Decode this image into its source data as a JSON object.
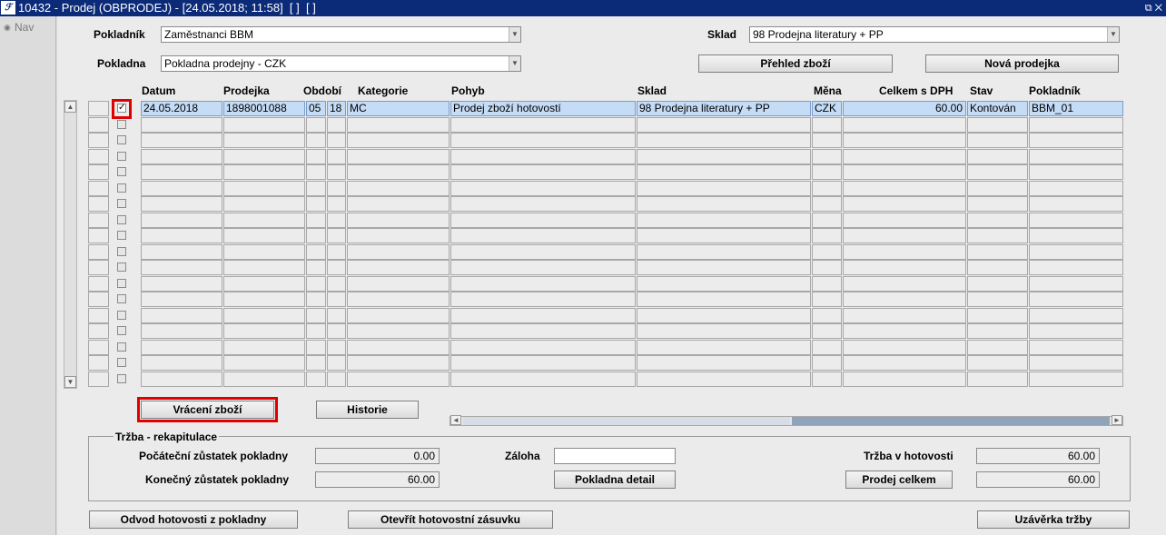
{
  "window": {
    "title": "10432 - Prodej (OBPRODEJ) - [24.05.2018; 11:58]  [ ]  [ ]",
    "app_icon": "forms-app-icon",
    "controls": "⧉ ✕"
  },
  "nav": {
    "label": "Nav"
  },
  "form": {
    "pokladnik_label": "Pokladník",
    "pokladnik_value": "Zaměstnanci BBM",
    "sklad_label": "Sklad",
    "sklad_value": "98 Prodejna literatury + PP",
    "pokladna_label": "Pokladna",
    "pokladna_value": "Pokladna prodejny - CZK",
    "prehled_button": "Přehled zboží",
    "nova_button": "Nová prodejka"
  },
  "table": {
    "headers": {
      "datum": "Datum",
      "prodejka": "Prodejka",
      "obdobi": "Období",
      "kategorie": "Kategorie",
      "pohyb": "Pohyb",
      "sklad": "Sklad",
      "mena": "Měna",
      "celkem": "Celkem s DPH",
      "stav": "Stav",
      "pokladnik": "Pokladník"
    },
    "row": {
      "datum": "24.05.2018",
      "prodejka": "1898001088",
      "obdobi_m": "05",
      "obdobi_y": "18",
      "kategorie": "MC",
      "pohyb": "Prodej zboží hotovostí",
      "sklad": "98 Prodejna literatury + PP",
      "mena": "CZK",
      "celkem": "60.00",
      "stav": "Kontován",
      "pokladnik": "BBM_01",
      "checked": true
    },
    "empty_rows": 17
  },
  "buttons": {
    "vraceni": "Vrácení zboží",
    "historie": "Historie"
  },
  "rekapitulace": {
    "title": "Tržba - rekapitulace",
    "pocatecni_label": "Počáteční zůstatek pokladny",
    "pocatecni_value": "0.00",
    "konecny_label": "Konečný zůstatek pokladny",
    "konecny_value": "60.00",
    "zaloha_label": "Záloha",
    "zaloha_value": "",
    "pokladna_detail_button": "Pokladna detail",
    "trzba_label": "Tržba v hotovosti",
    "trzba_value": "60.00",
    "prodej_celkem_button": "Prodej celkem",
    "prodej_celkem_value": "60.00"
  },
  "footer": {
    "odvod_button": "Odvod hotovosti z pokladny",
    "otevrit_button": "Otevřít hotovostní zásuvku",
    "uzaverka_button": "Uzávěrka tržby"
  },
  "colors": {
    "titlebar": "#0b2a78",
    "selected_row": "#c5dcf6",
    "highlight": "#e00000"
  }
}
